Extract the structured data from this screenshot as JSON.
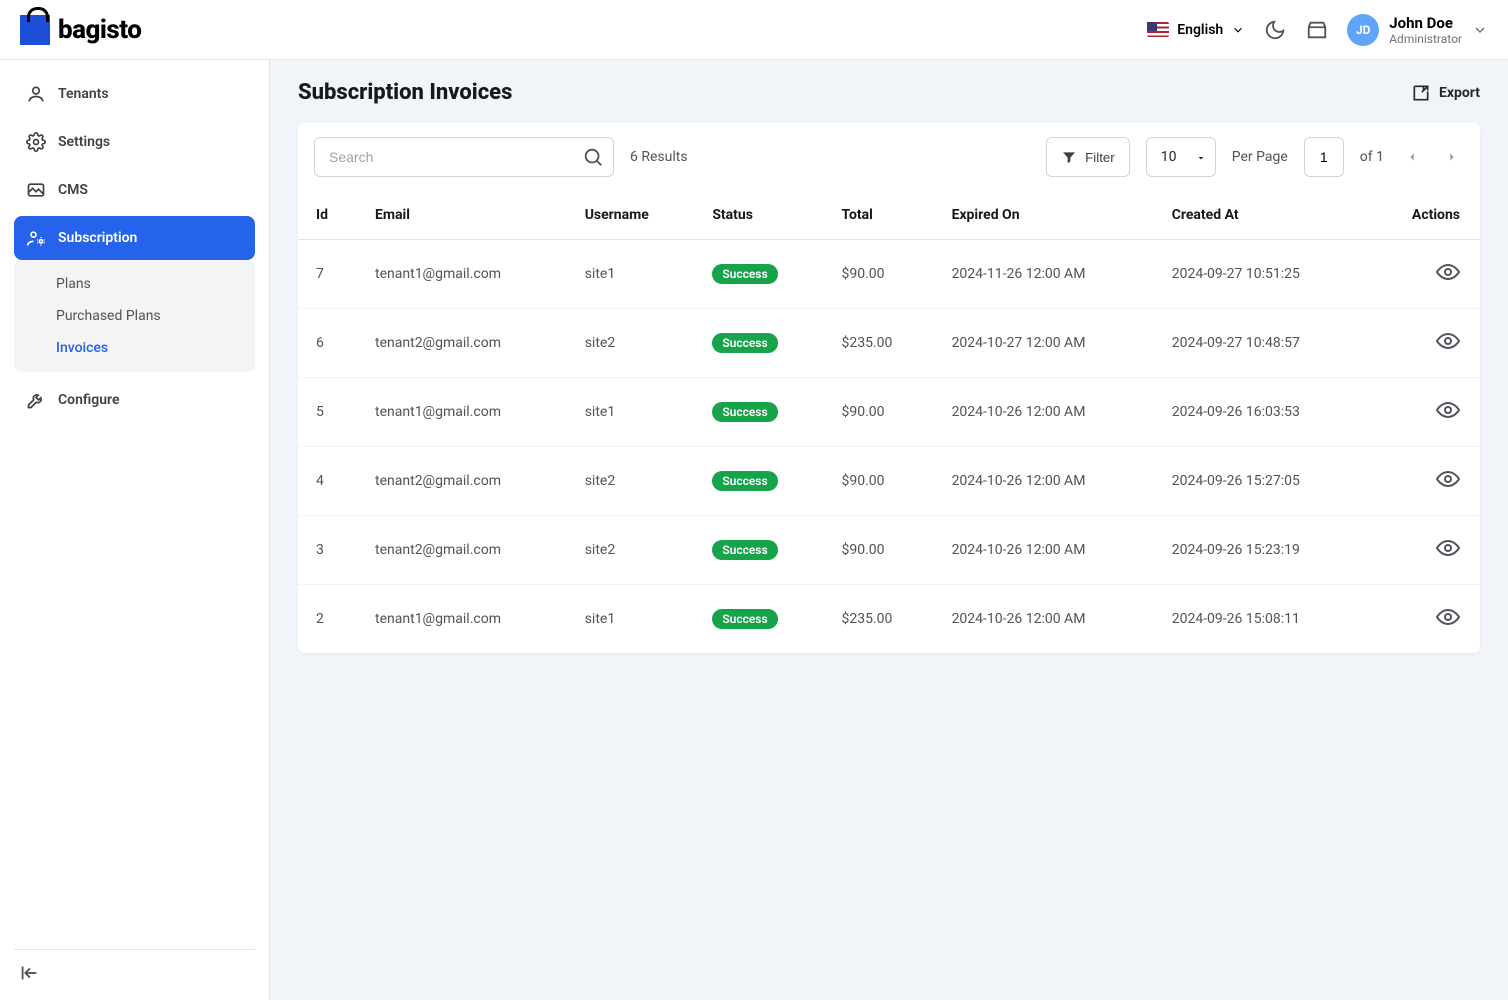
{
  "brand": {
    "name": "bagisto"
  },
  "header": {
    "language": "English",
    "user_name": "John Doe",
    "user_role": "Administrator",
    "avatar_initials": "JD"
  },
  "sidebar": {
    "items": [
      {
        "key": "tenants",
        "label": "Tenants"
      },
      {
        "key": "settings",
        "label": "Settings"
      },
      {
        "key": "cms",
        "label": "CMS"
      },
      {
        "key": "subscription",
        "label": "Subscription"
      },
      {
        "key": "configure",
        "label": "Configure"
      }
    ],
    "subscription_sub": {
      "plans": "Plans",
      "purchased": "Purchased Plans",
      "invoices": "Invoices"
    }
  },
  "page": {
    "title": "Subscription Invoices",
    "export_label": "Export"
  },
  "toolbar": {
    "search_placeholder": "Search",
    "results_text": "6 Results",
    "filter_label": "Filter",
    "page_size": "10",
    "per_page_label": "Per Page",
    "page_current": "1",
    "page_of": "of 1"
  },
  "table": {
    "columns": {
      "id": "Id",
      "email": "Email",
      "username": "Username",
      "status": "Status",
      "total": "Total",
      "expired": "Expired On",
      "created": "Created At",
      "actions": "Actions"
    },
    "rows": [
      {
        "id": "7",
        "email": "tenant1@gmail.com",
        "username": "site1",
        "status": "Success",
        "total": "$90.00",
        "expired": "2024-11-26 12:00 AM",
        "created": "2024-09-27 10:51:25"
      },
      {
        "id": "6",
        "email": "tenant2@gmail.com",
        "username": "site2",
        "status": "Success",
        "total": "$235.00",
        "expired": "2024-10-27 12:00 AM",
        "created": "2024-09-27 10:48:57"
      },
      {
        "id": "5",
        "email": "tenant1@gmail.com",
        "username": "site1",
        "status": "Success",
        "total": "$90.00",
        "expired": "2024-10-26 12:00 AM",
        "created": "2024-09-26 16:03:53"
      },
      {
        "id": "4",
        "email": "tenant2@gmail.com",
        "username": "site2",
        "status": "Success",
        "total": "$90.00",
        "expired": "2024-10-26 12:00 AM",
        "created": "2024-09-26 15:27:05"
      },
      {
        "id": "3",
        "email": "tenant2@gmail.com",
        "username": "site2",
        "status": "Success",
        "total": "$90.00",
        "expired": "2024-10-26 12:00 AM",
        "created": "2024-09-26 15:23:19"
      },
      {
        "id": "2",
        "email": "tenant1@gmail.com",
        "username": "site1",
        "status": "Success",
        "total": "$235.00",
        "expired": "2024-10-26 12:00 AM",
        "created": "2024-09-26 15:08:11"
      }
    ]
  }
}
